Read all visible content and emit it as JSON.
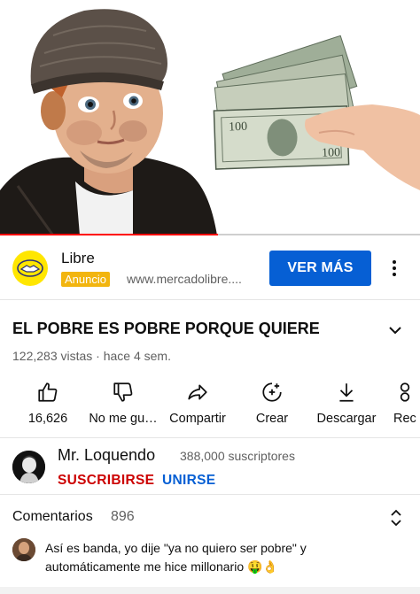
{
  "player": {
    "progress_fraction": 0.52
  },
  "ad": {
    "advertiser": "Libre",
    "badge": "Anuncio",
    "url": "www.mercadolibre....",
    "cta": "VER MÁS",
    "logo_icon": "handshake-icon",
    "logo_color": "#ffe600",
    "badge_color": "#f2b50f",
    "cta_color": "#065fd4"
  },
  "video": {
    "title": "EL POBRE ES POBRE PORQUE QUIERE",
    "meta": "122,283 vistas · hace 4 sem."
  },
  "actions": [
    {
      "label": "16,626",
      "icon": "thumbs-up-icon"
    },
    {
      "label": "No me gu…",
      "icon": "thumbs-down-icon"
    },
    {
      "label": "Compartir",
      "icon": "share-icon"
    },
    {
      "label": "Crear",
      "icon": "create-icon"
    },
    {
      "label": "Descargar",
      "icon": "download-icon"
    },
    {
      "label": "Rec",
      "icon": "remix-icon"
    }
  ],
  "channel": {
    "name": "Mr. Loquendo",
    "subscribers": "388,000 suscriptores",
    "subscribe_label": "SUSCRIBIRSE",
    "join_label": "UNIRSE",
    "subscribe_color": "#cc0000",
    "join_color": "#065fd4"
  },
  "comments": {
    "title": "Comentarios",
    "count": "896",
    "top_comment": "Así es banda, yo dije \"ya no quiero ser pobre\" y automáticamente me hice millonario 🤑👌"
  }
}
